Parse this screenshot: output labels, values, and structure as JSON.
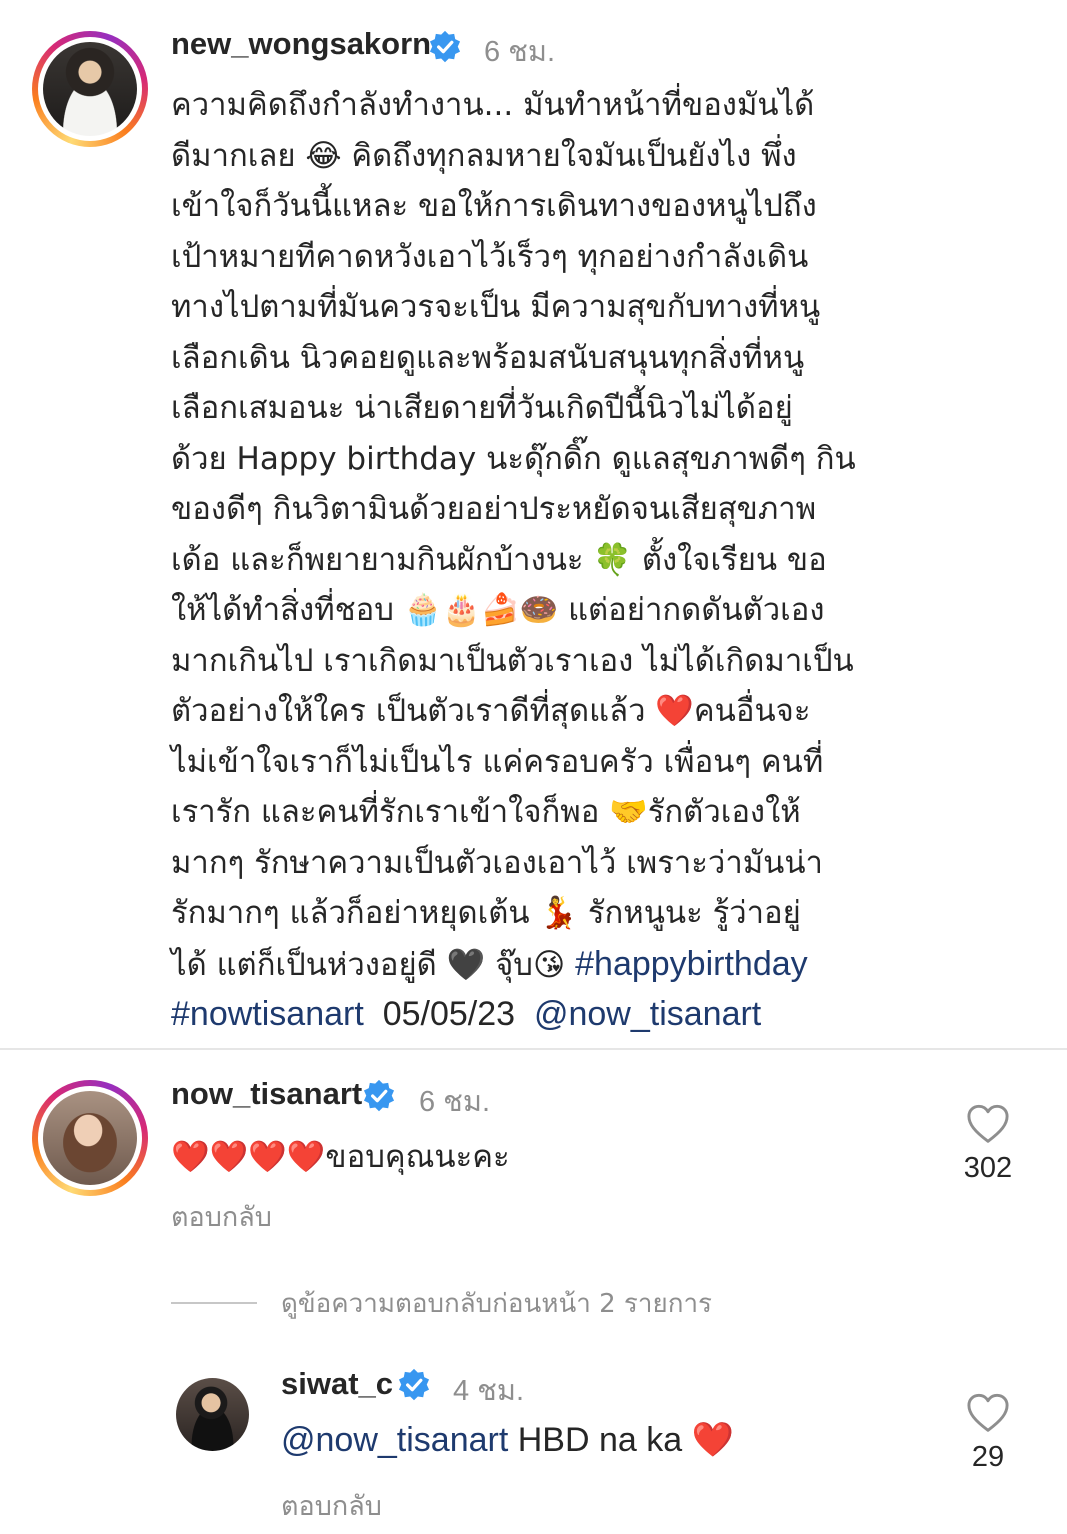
{
  "post": {
    "username": "new_wongsakorn",
    "verified": true,
    "time": "6 ชม.",
    "caption_lines": [
      "ความคิดถึงกำลังทำงาน... มันทำหน้าที่ของมันได้",
      "ดีมากเลย 😂 คิดถึงทุกลมหายใจมันเป็นยังไง พึ่ง",
      "เข้าใจก็วันนี้แหละ ขอให้การเดินทางของหนูไปถึง",
      "เป้าหมายทีคาดหวังเอาไว้เร็วๆ ทุกอย่างกำลังเดิน",
      "ทางไปตามที่มันควรจะเป็น มีความสุขกับทางที่หนู",
      "เลือกเดิน นิวคอยดูและพร้อมสนับสนุนทุกสิ่งที่หนู",
      "เลือกเสมอนะ  น่าเสียดายที่วันเกิดปีนี้นิวไม่ได้อยู่",
      "ด้วย Happy birthday นะดุ๊กดิ๊ก ดูแลสุขภาพดีๆ กิน",
      "ของดีๆ กินวิตามินด้วยอย่าประหยัดจนเสียสุขภาพ",
      "เด้อ  และก็พยายามกินผักบ้างนะ 🍀 ตั้งใจเรียน ขอ",
      "ให้ได้ทำสิ่งที่ชอบ 🧁🎂🍰🍩 แต่อย่ากดดันตัวเอง",
      "มากเกินไป เราเกิดมาเป็นตัวเราเอง ไม่ได้เกิดมาเป็น",
      "ตัวอย่างให้ใคร  เป็นตัวเราดีที่สุดแล้ว ❤️คนอื่นจะ",
      "ไม่เข้าใจเราก็ไม่เป็นไร แค่ครอบครัว เพื่อนๆ คนที่",
      "เรารัก และคนที่รักเราเข้าใจก็พอ 🤝รักตัวเองให้",
      "มากๆ รักษาความเป็นตัวเองเอาไว้ เพราะว่ามันน่า",
      "รักมากๆ แล้วก็อย่าหยุดเต้น 💃 รักหนูนะ รู้ว่าอยู่",
      "ได้ แต่ก็เป็นห่วงอยู่ดี 🖤  จุ๊บ😘 "
    ],
    "hashtag1": "#happybirthday",
    "hashtag2": "#nowtisanart",
    "date": "05/05/23",
    "mention": "@now_tisanart"
  },
  "comment": {
    "username": "now_tisanart",
    "verified": true,
    "time": "6 ชม.",
    "hearts": "❤️❤️❤️❤️",
    "text": "ขอบคุณนะคะ",
    "reply_label": "ตอบกลับ",
    "likes": "302"
  },
  "view_replies": {
    "label": "ดูข้อความตอบกลับก่อนหน้า 2 รายการ"
  },
  "reply": {
    "username": "siwat_c",
    "verified": true,
    "time": "4 ชม.",
    "mention": "@now_tisanart",
    "text": " HBD na ka ",
    "heart": "❤️",
    "reply_label": "ตอบกลับ",
    "likes": "29"
  },
  "colors": {
    "verified_blue": "#3897f0",
    "link": "#1e3a6e",
    "muted": "#8e8e8e",
    "text": "#262626",
    "heart_red": "#e0102b"
  },
  "icons": {
    "verified": "verified-badge-icon",
    "like": "heart-outline-icon"
  }
}
